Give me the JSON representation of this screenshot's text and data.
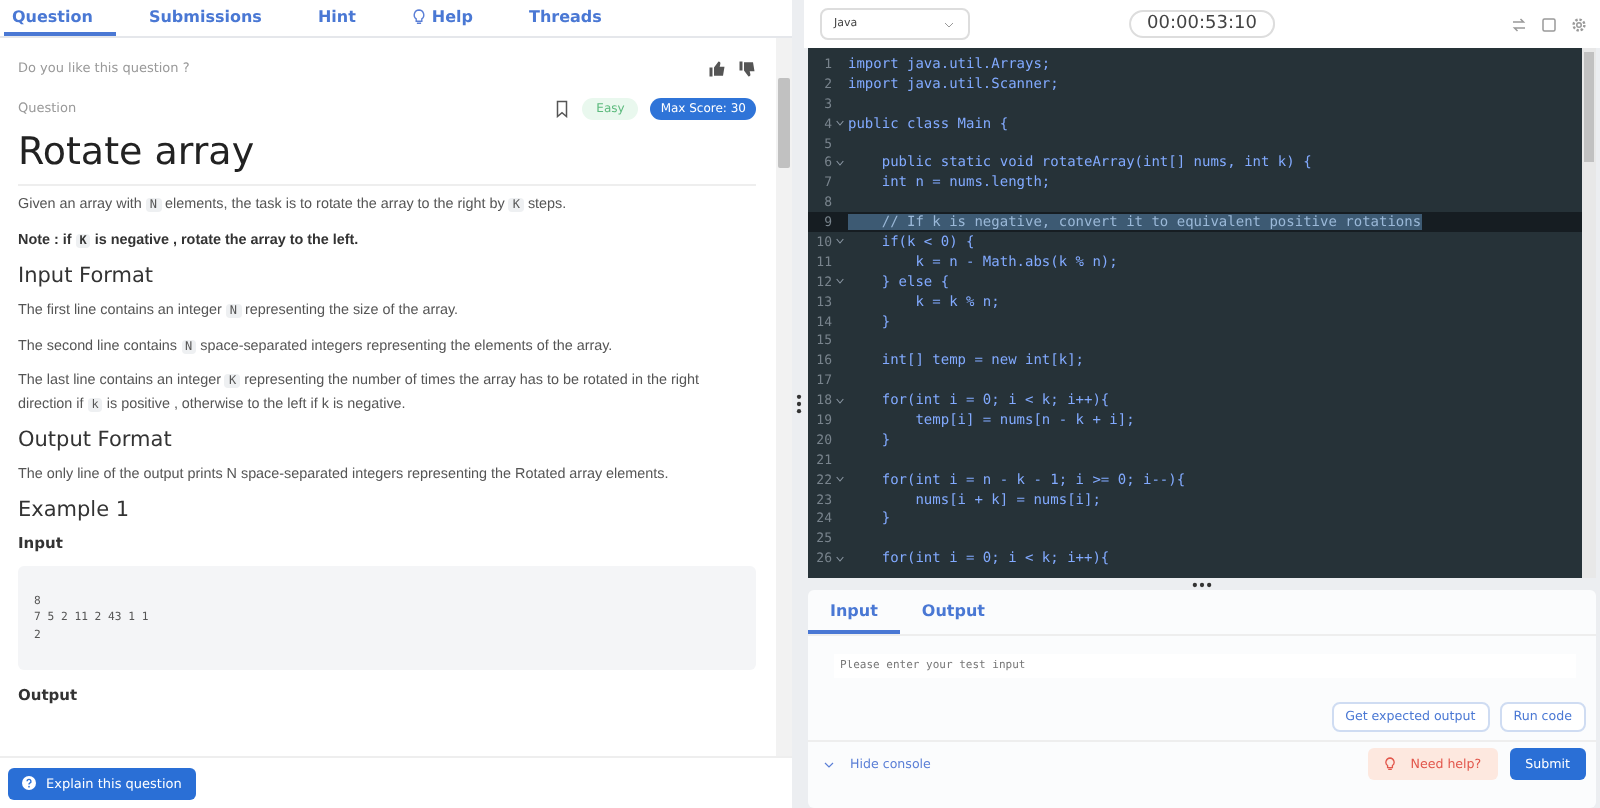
{
  "tabs": [
    {
      "label": "Question",
      "selected": true,
      "icon": false
    },
    {
      "label": "Submissions",
      "selected": false,
      "icon": false
    },
    {
      "label": "Hint",
      "selected": false,
      "icon": false
    },
    {
      "label": "Help",
      "selected": false,
      "icon": true
    },
    {
      "label": "Threads",
      "selected": false,
      "icon": false
    }
  ],
  "feedback": {
    "prompt": "Do you like this question ?"
  },
  "question": {
    "label": "Question",
    "difficulty": "Easy",
    "max_score": "Max Score: 30",
    "title": "Rotate array"
  },
  "body": [
    {
      "kind": "para",
      "bold": false,
      "parts": [
        {
          "text": "Given an array with ",
          "code": false
        },
        {
          "text": "N",
          "code": true
        },
        {
          "text": " elements, the task is to rotate the array to the right by ",
          "code": false
        },
        {
          "text": "K",
          "code": true
        },
        {
          "text": " steps.",
          "code": false
        }
      ]
    },
    {
      "kind": "para",
      "bold": true,
      "parts": [
        {
          "text": "Note : if ",
          "code": false
        },
        {
          "text": "K",
          "code": true
        },
        {
          "text": " is negative , rotate the array to the left.",
          "code": false
        }
      ]
    },
    {
      "kind": "heading",
      "text": "Input Format"
    },
    {
      "kind": "para",
      "bold": false,
      "parts": [
        {
          "text": "The first line contains an integer ",
          "code": false
        },
        {
          "text": "N",
          "code": true
        },
        {
          "text": " representing the size of the array.",
          "code": false
        }
      ]
    },
    {
      "kind": "para",
      "bold": false,
      "parts": [
        {
          "text": "The second line contains ",
          "code": false
        },
        {
          "text": "N",
          "code": true
        },
        {
          "text": " space-separated integers representing the elements of the array.",
          "code": false
        }
      ]
    },
    {
      "kind": "para",
      "bold": false,
      "parts": [
        {
          "text": "The last line contains an integer ",
          "code": false
        },
        {
          "text": "K",
          "code": true
        },
        {
          "text": " representing the number of times the array has to be rotated in the right direction if ",
          "code": false
        },
        {
          "text": "k",
          "code": true
        },
        {
          "text": " is positive , otherwise to the left if k is negative.",
          "code": false
        }
      ]
    },
    {
      "kind": "heading",
      "text": "Output Format"
    },
    {
      "kind": "para",
      "bold": false,
      "parts": [
        {
          "text": "The only line of the output prints N space-separated integers representing the Rotated array elements.",
          "code": false
        }
      ]
    },
    {
      "kind": "heading",
      "text": "Example 1"
    },
    {
      "kind": "subheading",
      "text": "Input"
    },
    {
      "kind": "code",
      "lines": [
        "8",
        "7 5 2 11 2 43 1 1",
        "2"
      ]
    },
    {
      "kind": "subheading",
      "text": "Output"
    }
  ],
  "explain_button": "Explain this question",
  "editor": {
    "language": "Java",
    "timer": "00:00:53:10",
    "lines": [
      {
        "n": "1",
        "text": "import java.util.Arrays;",
        "fold": false,
        "selected": false
      },
      {
        "n": "2",
        "text": "import java.util.Scanner;",
        "fold": false,
        "selected": false
      },
      {
        "n": "3",
        "fold": false,
        "selected": false
      },
      {
        "n": "4",
        "text": "public class Main {",
        "fold": true,
        "selected": false
      },
      {
        "n": "5",
        "fold": false,
        "selected": false
      },
      {
        "n": "6",
        "text": "    public static void rotateArray(int[] nums, int k) {",
        "fold": true,
        "selected": false
      },
      {
        "n": "7",
        "text": "    int n = nums.length;",
        "fold": false,
        "selected": false
      },
      {
        "n": "8",
        "fold": false,
        "selected": false
      },
      {
        "n": "9",
        "text": "    // If k is negative, convert it to equivalent positive rotations",
        "fold": false,
        "selected": true
      },
      {
        "n": "10",
        "text": "    if(k < 0) {",
        "fold": true,
        "selected": false
      },
      {
        "n": "11",
        "text": "        k = n - Math.abs(k % n);",
        "fold": false,
        "selected": false
      },
      {
        "n": "12",
        "text": "    } else {",
        "fold": true,
        "selected": false
      },
      {
        "n": "13",
        "text": "        k = k % n;",
        "fold": false,
        "selected": false
      },
      {
        "n": "14",
        "text": "    }",
        "fold": false,
        "selected": false
      },
      {
        "n": "15",
        "fold": false,
        "selected": false
      },
      {
        "n": "16",
        "text": "    int[] temp = new int[k];",
        "fold": false,
        "selected": false
      },
      {
        "n": "17",
        "fold": false,
        "selected": false
      },
      {
        "n": "18",
        "text": "    for(int i = 0; i < k; i++){",
        "fold": true,
        "selected": false
      },
      {
        "n": "19",
        "text": "        temp[i] = nums[n - k + i];",
        "fold": false,
        "selected": false
      },
      {
        "n": "20",
        "text": "    }",
        "fold": false,
        "selected": false
      },
      {
        "n": "21",
        "fold": false,
        "selected": false
      },
      {
        "n": "22",
        "text": "    for(int i = n - k - 1; i >= 0; i--){",
        "fold": true,
        "selected": false
      },
      {
        "n": "23",
        "text": "        nums[i + k] = nums[i];",
        "fold": false,
        "selected": false
      },
      {
        "n": "24",
        "text": "    }",
        "fold": false,
        "selected": false
      },
      {
        "n": "25",
        "fold": false,
        "selected": false
      },
      {
        "n": "26",
        "text": "    for(int i = 0; i < k; i++){",
        "fold": true,
        "selected": false
      }
    ]
  },
  "console": {
    "tabs": [
      {
        "label": "Input",
        "selected": true
      },
      {
        "label": "Output",
        "selected": false
      }
    ],
    "input": {
      "placeholder": "Please enter your test input"
    },
    "buttons": [
      "Get expected output",
      "Run code"
    ],
    "hide": "Hide console",
    "help": "Need help?",
    "submit": "Submit"
  }
}
